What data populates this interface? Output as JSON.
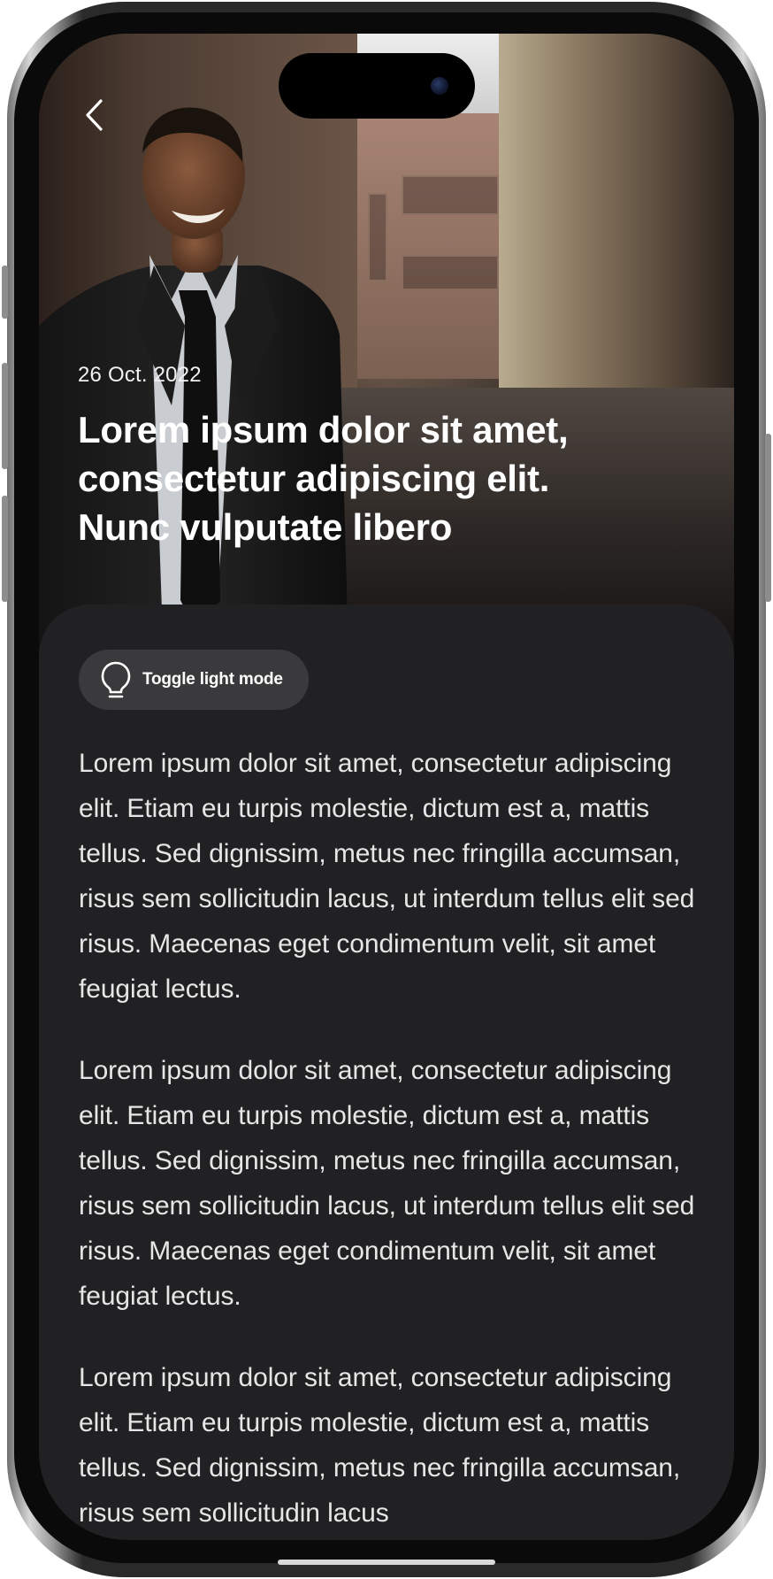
{
  "article": {
    "date": "26 Oct. 2022",
    "title": "Lorem ipsum dolor sit amet, consectetur adipiscing elit. Nunc vulputate libero",
    "paragraphs": [
      "Lorem ipsum dolor sit amet, consectetur adipiscing elit. Etiam eu turpis molestie, dictum est a, mattis tellus. Sed dignissim, metus nec fringilla accumsan, risus sem sollicitudin lacus, ut interdum tellus elit sed risus. Maecenas eget condimentum velit, sit amet feugiat lectus.",
      "Lorem ipsum dolor sit amet, consectetur adipiscing elit. Etiam eu turpis molestie, dictum est a, mattis tellus. Sed dignissim, metus nec fringilla accumsan, risus sem sollicitudin lacus, ut interdum tellus elit sed risus. Maecenas eget condimentum velit, sit amet feugiat lectus.",
      "Lorem ipsum dolor sit amet, consectetur adipiscing elit. Etiam eu turpis molestie, dictum est a, mattis tellus. Sed dignissim, metus nec fringilla accumsan, risus sem sollicitudin lacus"
    ]
  },
  "toggle": {
    "label": "Toggle light mode",
    "icon": "lightbulb-icon"
  },
  "navigation": {
    "back_icon": "chevron-left-icon"
  },
  "colors": {
    "sheet_background": "#212123",
    "toggle_background": "#3a3a3c",
    "text_primary": "#ffffff",
    "text_body": "#e6e6e6"
  }
}
